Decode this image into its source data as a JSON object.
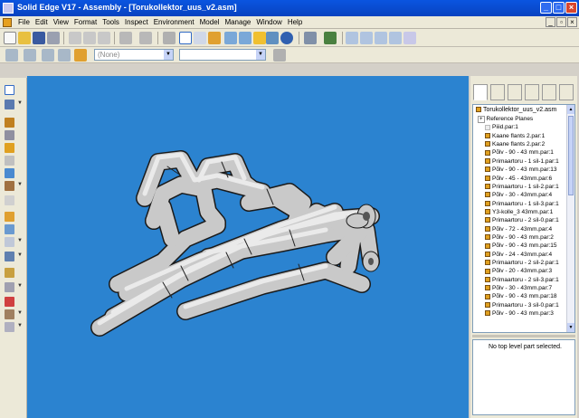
{
  "window": {
    "title": "Solid Edge V17 - Assembly - [Torukollektor_uus_v2.asm]",
    "minimize": "_",
    "maximize": "□",
    "close": "×"
  },
  "menu": [
    "File",
    "Edit",
    "View",
    "Format",
    "Tools",
    "Inspect",
    "Environment",
    "Model",
    "Manage",
    "Window",
    "Help"
  ],
  "toolbar2": {
    "layer_combo": "(None)",
    "view_combo": ""
  },
  "pathfinder": {
    "root": "Torukollektor_uus_v2.asm",
    "items": [
      "Reference Planes",
      "Piiid.par:1",
      "Kaane flants 2.par:1",
      "Kaane flants 2.par:2",
      "Põlv - 90 - 43 mm.par:1",
      "Primaartoru - 1 sil-1.par:1",
      "Põlv - 90 - 43 mm.par:13",
      "Põlv - 45 - 43mm.par:6",
      "Primaartoru - 1 sil-2.par:1",
      "Põlv - 30 - 43mm.par:4",
      "Primaartoru - 1 sil-3.par:1",
      "Y3-kolle_3 43mm.par:1",
      "Primaartoru - 2 sil-0.par:1",
      "Põlv - 72 - 43mm.par:4",
      "Põlv - 90 - 43 mm.par:2",
      "Põlv - 90 - 43 mm.par:15",
      "Põlv - 24 - 43mm.par:4",
      "Primaartoru - 2 sil-2.par:1",
      "Põlv - 20 - 43mm.par:3",
      "Primaartoru - 2 sil-3.par:1",
      "Põlv - 30 - 43mm.par:7",
      "Põlv - 90 - 43 mm.par:18",
      "Primaartoru - 3 sil-0.par:1",
      "Põlv - 90 - 43 mm.par:3"
    ],
    "status": "No top level part selected."
  },
  "colors": {
    "viewport": "#2b83d0",
    "pipe": "#c6c6c6",
    "titlebar": "#0842c0"
  }
}
